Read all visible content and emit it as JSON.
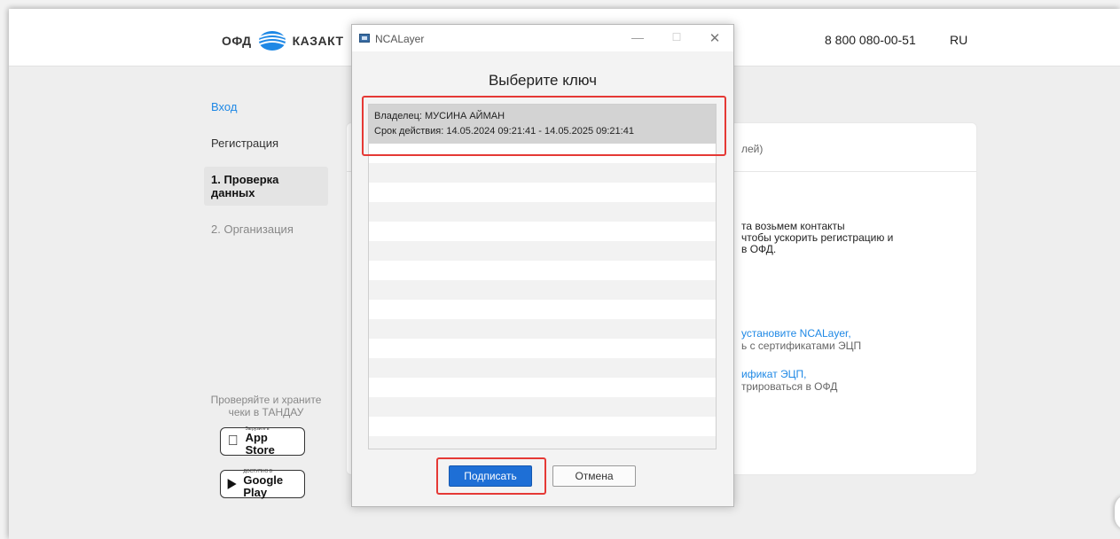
{
  "header": {
    "logo_left": "ОФД",
    "logo_right": "КАЗАКТ",
    "phone": "8 800 080-00-51",
    "lang": "RU"
  },
  "sidebar": {
    "items": [
      {
        "label": "Вход"
      },
      {
        "label": "Регистрация"
      },
      {
        "label": "1. Проверка данных"
      },
      {
        "label": "2. Организация"
      }
    ]
  },
  "promo": {
    "text": "Проверяйте и храните чеки в ТАНДАУ",
    "app_store_small": "Загрузите в",
    "app_store_big": "App Store",
    "google_play_small": "ДОСТУПНО В",
    "google_play_big": "Google Play"
  },
  "card": {
    "header_fragment": "лей)",
    "paragraph": "та возьмем контакты\nчтобы ускорить регистрацию и\nв ОФД.",
    "link1": "установите NCALayer,",
    "note1": "ь с сертификатами ЭЦП",
    "link2": "ификат ЭЦП,",
    "note2": "трироваться в ОФД"
  },
  "dialog": {
    "title": "NCALayer",
    "heading": "Выберите ключ",
    "selected_key": {
      "owner": "Владелец: МУСИНА АЙМАН",
      "validity": "Срок действия: 14.05.2024 09:21:41 - 14.05.2025 09:21:41"
    },
    "sign_label": "Подписать",
    "cancel_label": "Отмена"
  },
  "colors": {
    "accent_blue": "#1e88e5",
    "button_blue": "#1e6fd6",
    "highlight_red": "#e53935"
  }
}
